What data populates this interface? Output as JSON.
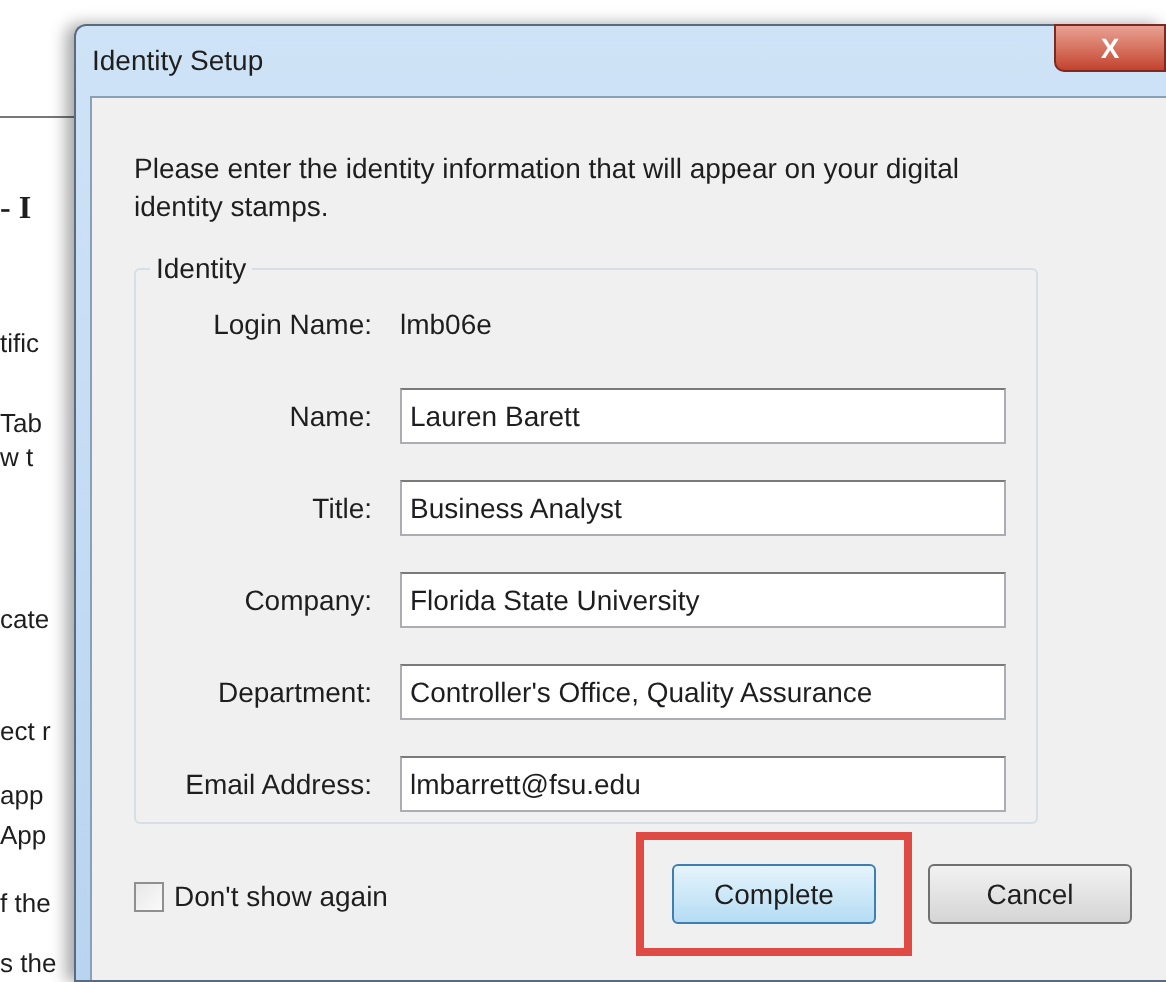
{
  "background_fragments": [
    {
      "text": "- I",
      "bold": true
    },
    {
      "text": "tific",
      "bold": false
    },
    {
      "text": "Tab",
      "bold": false
    },
    {
      "text": "w t",
      "bold": false
    },
    {
      "text": "cate",
      "bold": false
    },
    {
      "text": "ect r",
      "bold": false
    },
    {
      "text": "app",
      "bold": false
    },
    {
      "text": "App",
      "bold": false
    },
    {
      "text": "f the",
      "bold": false
    },
    {
      "text": "s the",
      "bold": false
    }
  ],
  "window": {
    "title": "Identity Setup",
    "close": "X"
  },
  "intro": "Please enter the identity information that will appear on your digital identity stamps.",
  "group": {
    "title": "Identity",
    "fields": [
      {
        "kind": "text",
        "label": "Login Name:",
        "value": "lmb06e"
      },
      {
        "kind": "input",
        "label": "Name:",
        "value": "Lauren Barett"
      },
      {
        "kind": "input",
        "label": "Title:",
        "value": "Business Analyst"
      },
      {
        "kind": "input",
        "label": "Company:",
        "value": "Florida State University"
      },
      {
        "kind": "input",
        "label": "Department:",
        "value": "Controller's Office, Quality Assurance"
      },
      {
        "kind": "input",
        "label": "Email Address:",
        "value": "lmbarrett@fsu.edu"
      }
    ]
  },
  "dont_show_again": {
    "label": "Don't show again",
    "checked": false
  },
  "buttons": [
    {
      "label": "Complete",
      "default": true,
      "highlighted": true
    },
    {
      "label": "Cancel",
      "default": false,
      "highlighted": false
    }
  ]
}
